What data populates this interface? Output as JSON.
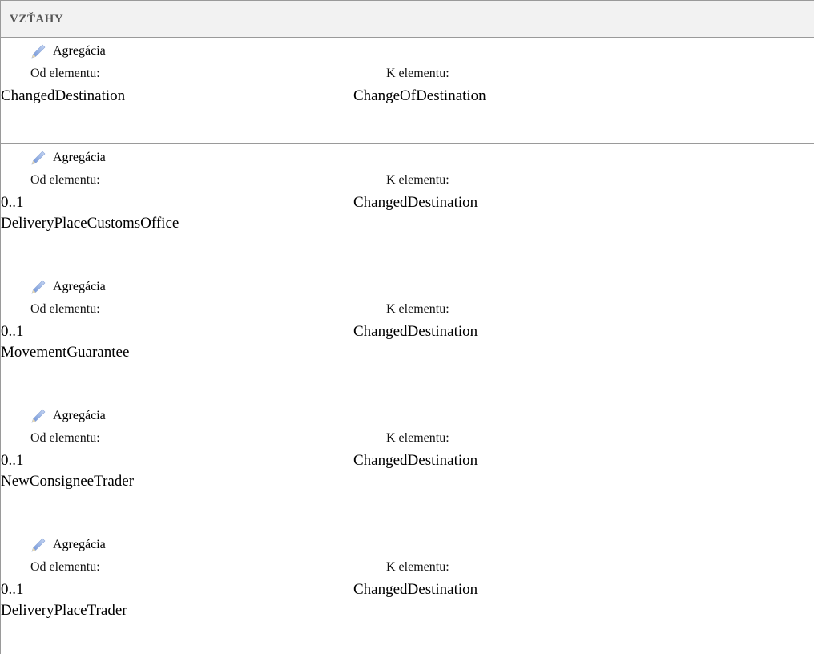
{
  "section": {
    "title": "VZŤAHY"
  },
  "relations": [
    {
      "type": "Agregácia",
      "from_label": "Od elementu:",
      "to_label": "K elementu:",
      "from_multiplicity": "",
      "from_element": "ChangedDestination",
      "to_element": "ChangeOfDestination"
    },
    {
      "type": "Agregácia",
      "from_label": "Od elementu:",
      "to_label": "K elementu:",
      "from_multiplicity": "0..1",
      "from_element": "DeliveryPlaceCustomsOffice",
      "to_element": "ChangedDestination"
    },
    {
      "type": "Agregácia",
      "from_label": "Od elementu:",
      "to_label": "K elementu:",
      "from_multiplicity": "0..1",
      "from_element": "MovementGuarantee",
      "to_element": "ChangedDestination"
    },
    {
      "type": "Agregácia",
      "from_label": "Od elementu:",
      "to_label": "K elementu:",
      "from_multiplicity": "0..1",
      "from_element": "NewConsigneeTrader",
      "to_element": "ChangedDestination"
    },
    {
      "type": "Agregácia",
      "from_label": "Od elementu:",
      "to_label": "K elementu:",
      "from_multiplicity": "0..1",
      "from_element": "DeliveryPlaceTrader",
      "to_element": "ChangedDestination"
    }
  ],
  "icons": {
    "relation_icon": "pencil-icon"
  }
}
